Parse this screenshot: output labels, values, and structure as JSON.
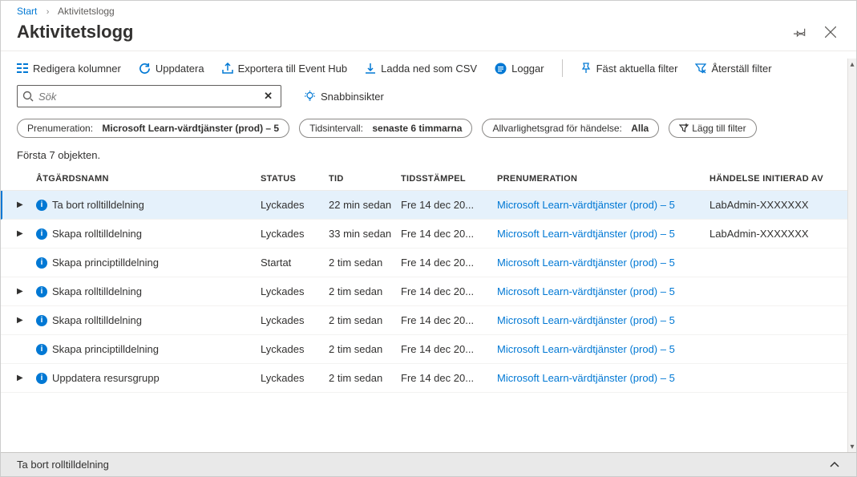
{
  "breadcrumb": {
    "root": "Start",
    "current": "Aktivitetslogg"
  },
  "page_title": "Aktivitetslogg",
  "toolbar": {
    "edit_columns": "Redigera kolumner",
    "refresh": "Uppdatera",
    "export": "Exportera till Event Hub",
    "download": "Ladda ned som CSV",
    "logs": "Loggar",
    "pin": "Fäst aktuella filter",
    "reset": "Återställ filter"
  },
  "search": {
    "placeholder": "Sök"
  },
  "quick_insights": "Snabbinsikter",
  "pills": {
    "subscription": {
      "label": "Prenumeration:",
      "value": "Microsoft Learn-värdtjänster (prod) – 5"
    },
    "timespan": {
      "label": "Tidsintervall:",
      "value": "senaste 6 timmarna"
    },
    "severity": {
      "label": "Allvarlighetsgrad för händelse:",
      "value": "Alla"
    },
    "add_filter": "Lägg till filter"
  },
  "count_label": "Första 7 objekten.",
  "columns": {
    "action": "ÅTGÄRDSNAMN",
    "status": "STATUS",
    "time": "TID",
    "timestamp": "TIDSSTÄMPEL",
    "subscription": "PRENUMERATION",
    "initiated_by": "HÄNDELSE INITIERAD AV"
  },
  "rows": [
    {
      "expandable": true,
      "selected": true,
      "name": "Ta bort rolltilldelning",
      "status": "Lyckades",
      "time": "22 min sedan",
      "ts": "Fre 14 dec 20...",
      "sub": "Microsoft Learn-värdtjänster (prod) – 5",
      "init": "LabAdmin-XXXXXXX"
    },
    {
      "expandable": true,
      "selected": false,
      "name": "Skapa rolltilldelning",
      "status": "Lyckades",
      "time": "33 min sedan",
      "ts": "Fre 14 dec 20...",
      "sub": "Microsoft Learn-värdtjänster (prod) – 5",
      "init": "LabAdmin-XXXXXXX"
    },
    {
      "expandable": false,
      "selected": false,
      "name": "Skapa principtilldelning",
      "status": "Startat",
      "time": "2 tim sedan",
      "ts": "Fre 14 dec 20...",
      "sub": "Microsoft Learn-värdtjänster (prod) – 5",
      "init": ""
    },
    {
      "expandable": true,
      "selected": false,
      "name": "Skapa rolltilldelning",
      "status": "Lyckades",
      "time": "2 tim sedan",
      "ts": "Fre 14 dec 20...",
      "sub": "Microsoft Learn-värdtjänster (prod) – 5",
      "init": ""
    },
    {
      "expandable": true,
      "selected": false,
      "name": "Skapa rolltilldelning",
      "status": "Lyckades",
      "time": "2 tim sedan",
      "ts": "Fre 14 dec 20...",
      "sub": "Microsoft Learn-värdtjänster (prod) – 5",
      "init": ""
    },
    {
      "expandable": false,
      "selected": false,
      "name": "Skapa principtilldelning",
      "status": "Lyckades",
      "time": "2 tim sedan",
      "ts": "Fre 14 dec 20...",
      "sub": "Microsoft Learn-värdtjänster (prod) – 5",
      "init": ""
    },
    {
      "expandable": true,
      "selected": false,
      "name": "Uppdatera resursgrupp",
      "status": "Lyckades",
      "time": "2 tim sedan",
      "ts": "Fre 14 dec 20...",
      "sub": "Microsoft Learn-värdtjänster (prod) – 5",
      "init": ""
    }
  ],
  "bottom_panel": "Ta bort rolltilldelning"
}
